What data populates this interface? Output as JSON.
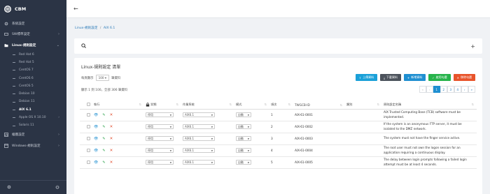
{
  "app": {
    "name": "CBM"
  },
  "sidebar": {
    "items": [
      {
        "label": "系統設定",
        "icon": "gear-icon"
      },
      {
        "label": "SW標準設定",
        "icon": "switch-icon"
      },
      {
        "label": "Linux-規則設定",
        "icon": "folder-icon",
        "open": true
      },
      {
        "label": "繪圖設定",
        "icon": "chart-icon"
      },
      {
        "label": "Windows-規則設定",
        "icon": "window-icon"
      }
    ],
    "linux_children": [
      {
        "label": "Red Hat 6"
      },
      {
        "label": "Red Hat 5"
      },
      {
        "label": "CentOS 7"
      },
      {
        "label": "CentOS 6"
      },
      {
        "label": "CentOS 5"
      },
      {
        "label": "Debian 10"
      },
      {
        "label": "Debian 11"
      },
      {
        "label": "AIX 6.1",
        "active": true
      },
      {
        "label": "Apple OS X 10.10"
      },
      {
        "label": "Solaris 11"
      }
    ]
  },
  "topbar": {
    "back_icon": "arrow-left-icon"
  },
  "breadcrumb": {
    "parent": "Linux-規則設定",
    "current": "AIX 6.1"
  },
  "main": {
    "title": "Linux-規則設定 清單",
    "per_page_prefix": "每頁顯示",
    "per_page_value": "100",
    "per_page_suffix": "筆資料",
    "summary": "顯示 1 到 100，全部 306 筆資料",
    "buttons": {
      "upload": "上傳資料",
      "download": "下載資料",
      "add": "新增資料",
      "enable": "啟用勾選",
      "remove": "移除勾選"
    },
    "pager": {
      "prev2": "«",
      "prev": "‹",
      "pages": [
        "1",
        "2",
        "3",
        "4"
      ],
      "next": "›",
      "next2": "»",
      "active": "1"
    },
    "columns": {
      "action": "執行",
      "status": "狀態",
      "os": "作業系統",
      "mode": "模式",
      "order": "項次",
      "twgcb": "TWGCB-ID",
      "category": "類別",
      "name": "原則設定名稱"
    },
    "rows": [
      {
        "status": "停用",
        "os": "AIX6.1",
        "mode": "自動",
        "order": "1",
        "id": "AIX-61-0001",
        "category": "",
        "name": "AIX Trusted Computing Base (TCB) software must be implemented."
      },
      {
        "status": "停用",
        "os": "AIX6.1",
        "mode": "自動",
        "order": "2",
        "id": "AIX-61-0002",
        "category": "",
        "name": "If the system is an anonymous FTP server, it must be isolated to the DMZ network."
      },
      {
        "status": "停用",
        "os": "AIX6.1",
        "mode": "自動",
        "order": "3",
        "id": "AIX-61-0003",
        "category": "",
        "name": "The system must not have the finger service active."
      },
      {
        "status": "停用",
        "os": "AIX6.1",
        "mode": "自動",
        "order": "4",
        "id": "AIX-61-0004",
        "category": "",
        "name": "The root user must not own the logon session for an application requiring a continuous display."
      },
      {
        "status": "停用",
        "os": "AIX6.1",
        "mode": "自動",
        "order": "5",
        "id": "AIX-61-0005",
        "category": "",
        "name": "The delay between login prompts following a failed login attempt must be at least 4 seconds."
      }
    ]
  }
}
